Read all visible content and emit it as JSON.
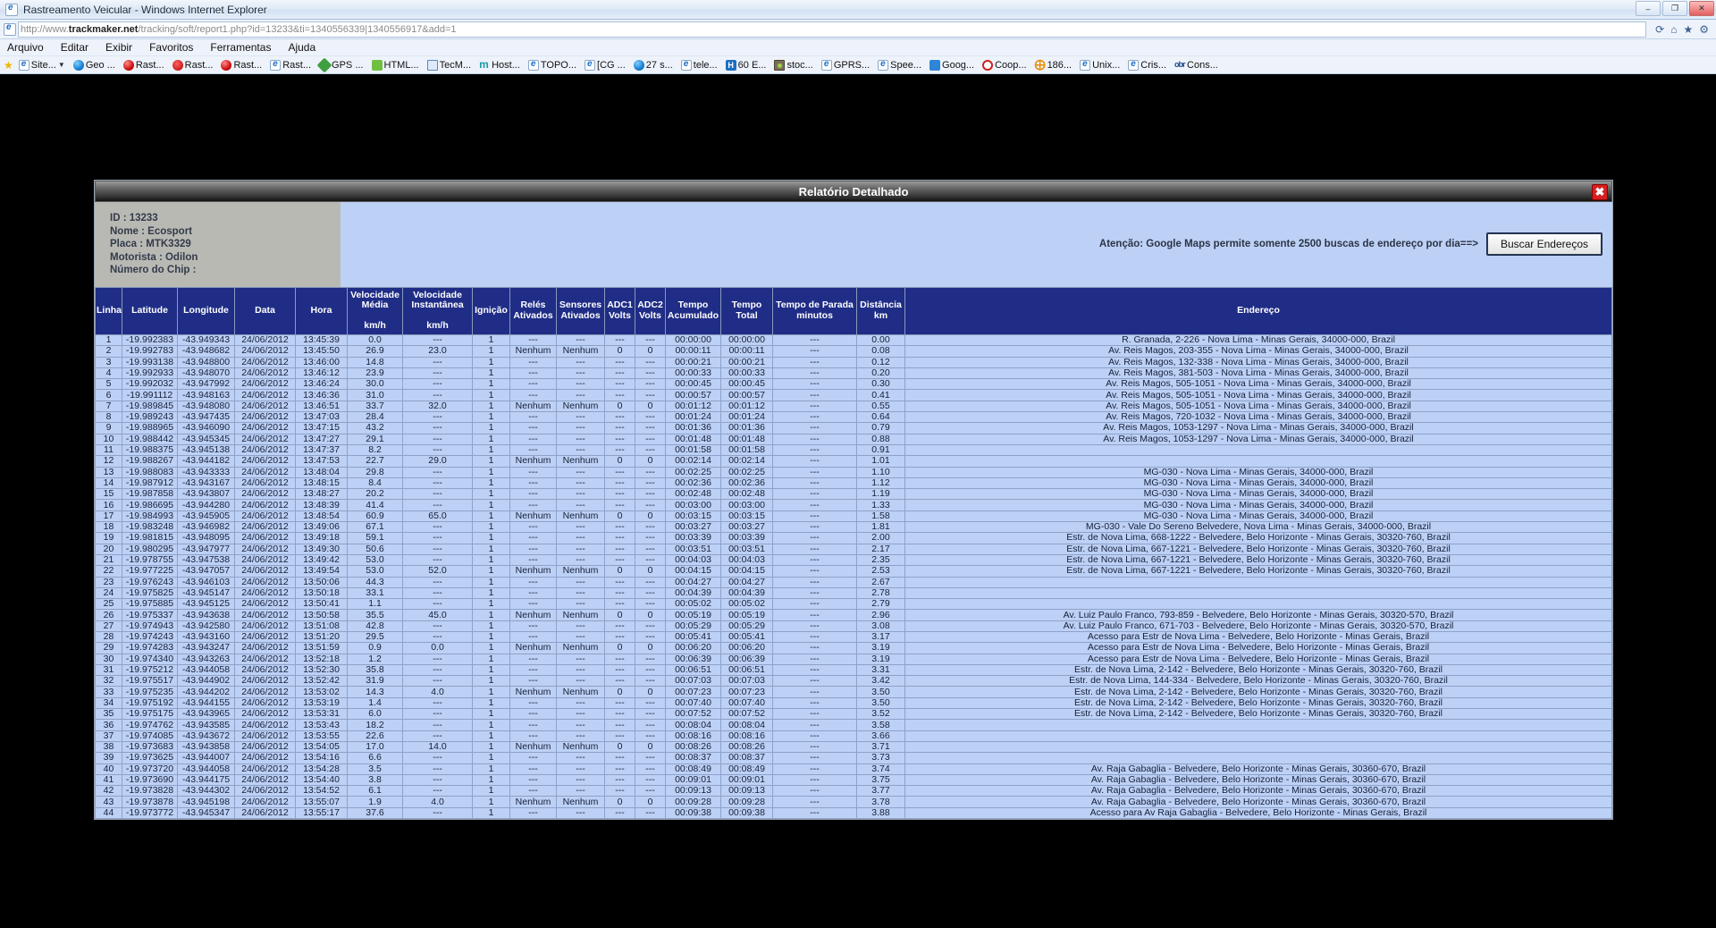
{
  "browser": {
    "window_title": "Rastreamento Veicular - Windows Internet Explorer",
    "url_prefix": "http://www.",
    "url_domain": "trackmaker.net",
    "url_path": "/tracking/soft/report1.php?id=13233&ti=1340556339|1340556917&add=1",
    "win_buttons": {
      "minimize": "–",
      "maximize": "❐",
      "close": "✕"
    },
    "addr_icons": {
      "refresh": "⟳",
      "home": "⌂",
      "star": "★",
      "gear": "⚙"
    },
    "menu": [
      "Arquivo",
      "Editar",
      "Exibir",
      "Favoritos",
      "Ferramentas",
      "Ajuda"
    ],
    "bookmarks": [
      {
        "label": "Site...",
        "icon": "ie-icon",
        "caret": true
      },
      {
        "label": "Geo ...",
        "icon": "globe-icon"
      },
      {
        "label": "Rast...",
        "icon": "red-globe-icon"
      },
      {
        "label": "Rast...",
        "icon": "red-swirl-icon"
      },
      {
        "label": "Rast...",
        "icon": "red-globe-icon"
      },
      {
        "label": "Rast...",
        "icon": "ie-icon"
      },
      {
        "label": "GPS ...",
        "icon": "green-diamond-icon"
      },
      {
        "label": "HTML...",
        "icon": "html-icon"
      },
      {
        "label": "TecM...",
        "icon": "blue-doc-icon"
      },
      {
        "label": "Host...",
        "icon": "teal-m-icon"
      },
      {
        "label": "TOPO...",
        "icon": "ie-icon"
      },
      {
        "label": "[CG ...",
        "icon": "ie-icon"
      },
      {
        "label": "27 s...",
        "icon": "globe-icon"
      },
      {
        "label": "tele...",
        "icon": "ie-icon"
      },
      {
        "label": "60 E...",
        "icon": "blue-h-icon"
      },
      {
        "label": "stoc...",
        "icon": "dark-box-icon"
      },
      {
        "label": "GPRS...",
        "icon": "ie-icon"
      },
      {
        "label": "Spee...",
        "icon": "ie-icon"
      },
      {
        "label": "Goog...",
        "icon": "google-icon"
      },
      {
        "label": "Coop...",
        "icon": "red-circle-icon"
      },
      {
        "label": "186...",
        "icon": "orange-icon"
      },
      {
        "label": "Unix...",
        "icon": "ie-icon"
      },
      {
        "label": "Cris...",
        "icon": "ie-icon"
      },
      {
        "label": "Cons...",
        "icon": "obr-icon"
      }
    ]
  },
  "report": {
    "title": "Relatório Detalhado",
    "close_label": "✖",
    "vehicle_info": [
      "ID : 13233",
      "Nome : Ecosport",
      "Placa : MTK3329",
      "Motorista : Odilon",
      "Número do Chip :"
    ],
    "warning": "Atenção: Google Maps permite somente 2500 buscas de endereço por dia==>",
    "search_button": "Buscar Endereços",
    "columns": [
      "Linha",
      "Latitude",
      "Longitude",
      "Data",
      "Hora",
      "Velocidade Média km/h",
      "Velocidade Instantânea km/h",
      "Ignição",
      "Relés Ativados",
      "Sensores Ativados",
      "ADC1 Volts",
      "ADC2 Volts",
      "Tempo Acumulado",
      "Tempo Total",
      "Tempo de Parada minutos",
      "Distância km",
      "Endereço"
    ],
    "rows": [
      [
        "1",
        "-19.992383",
        "-43.949343",
        "24/06/2012",
        "13:45:39",
        "0.0",
        "---",
        "1",
        "---",
        "---",
        "---",
        "---",
        "00:00:00",
        "00:00:00",
        "---",
        "0.00",
        "R. Granada, 2-226 - Nova Lima - Minas Gerais, 34000-000, Brazil"
      ],
      [
        "2",
        "-19.992783",
        "-43.948682",
        "24/06/2012",
        "13:45:50",
        "26.9",
        "23.0",
        "1",
        "Nenhum",
        "Nenhum",
        "0",
        "0",
        "00:00:11",
        "00:00:11",
        "---",
        "0.08",
        "Av. Reis Magos, 203-355 - Nova Lima - Minas Gerais, 34000-000, Brazil"
      ],
      [
        "3",
        "-19.993138",
        "-43.948800",
        "24/06/2012",
        "13:46:00",
        "14.8",
        "---",
        "1",
        "---",
        "---",
        "---",
        "---",
        "00:00:21",
        "00:00:21",
        "---",
        "0.12",
        "Av. Reis Magos, 132-338 - Nova Lima - Minas Gerais, 34000-000, Brazil"
      ],
      [
        "4",
        "-19.992933",
        "-43.948070",
        "24/06/2012",
        "13:46:12",
        "23.9",
        "---",
        "1",
        "---",
        "---",
        "---",
        "---",
        "00:00:33",
        "00:00:33",
        "---",
        "0.20",
        "Av. Reis Magos, 381-503 - Nova Lima - Minas Gerais, 34000-000, Brazil"
      ],
      [
        "5",
        "-19.992032",
        "-43.947992",
        "24/06/2012",
        "13:46:24",
        "30.0",
        "---",
        "1",
        "---",
        "---",
        "---",
        "---",
        "00:00:45",
        "00:00:45",
        "---",
        "0.30",
        "Av. Reis Magos, 505-1051 - Nova Lima - Minas Gerais, 34000-000, Brazil"
      ],
      [
        "6",
        "-19.991112",
        "-43.948163",
        "24/06/2012",
        "13:46:36",
        "31.0",
        "---",
        "1",
        "---",
        "---",
        "---",
        "---",
        "00:00:57",
        "00:00:57",
        "---",
        "0.41",
        "Av. Reis Magos, 505-1051 - Nova Lima - Minas Gerais, 34000-000, Brazil"
      ],
      [
        "7",
        "-19.989845",
        "-43.948080",
        "24/06/2012",
        "13:46:51",
        "33.7",
        "32.0",
        "1",
        "Nenhum",
        "Nenhum",
        "0",
        "0",
        "00:01:12",
        "00:01:12",
        "---",
        "0.55",
        "Av. Reis Magos, 505-1051 - Nova Lima - Minas Gerais, 34000-000, Brazil"
      ],
      [
        "8",
        "-19.989243",
        "-43.947435",
        "24/06/2012",
        "13:47:03",
        "28.4",
        "---",
        "1",
        "---",
        "---",
        "---",
        "---",
        "00:01:24",
        "00:01:24",
        "---",
        "0.64",
        "Av. Reis Magos, 720-1032 - Nova Lima - Minas Gerais, 34000-000, Brazil"
      ],
      [
        "9",
        "-19.988965",
        "-43.946090",
        "24/06/2012",
        "13:47:15",
        "43.2",
        "---",
        "1",
        "---",
        "---",
        "---",
        "---",
        "00:01:36",
        "00:01:36",
        "---",
        "0.79",
        "Av. Reis Magos, 1053-1297 - Nova Lima - Minas Gerais, 34000-000, Brazil"
      ],
      [
        "10",
        "-19.988442",
        "-43.945345",
        "24/06/2012",
        "13:47:27",
        "29.1",
        "---",
        "1",
        "---",
        "---",
        "---",
        "---",
        "00:01:48",
        "00:01:48",
        "---",
        "0.88",
        "Av. Reis Magos, 1053-1297 - Nova Lima - Minas Gerais, 34000-000, Brazil"
      ],
      [
        "11",
        "-19.988375",
        "-43.945138",
        "24/06/2012",
        "13:47:37",
        "8.2",
        "---",
        "1",
        "---",
        "---",
        "---",
        "---",
        "00:01:58",
        "00:01:58",
        "---",
        "0.91",
        ""
      ],
      [
        "12",
        "-19.988267",
        "-43.944182",
        "24/06/2012",
        "13:47:53",
        "22.7",
        "29.0",
        "1",
        "Nenhum",
        "Nenhum",
        "0",
        "0",
        "00:02:14",
        "00:02:14",
        "---",
        "1.01",
        ""
      ],
      [
        "13",
        "-19.988083",
        "-43.943333",
        "24/06/2012",
        "13:48:04",
        "29.8",
        "---",
        "1",
        "---",
        "---",
        "---",
        "---",
        "00:02:25",
        "00:02:25",
        "---",
        "1.10",
        "MG-030 - Nova Lima - Minas Gerais, 34000-000, Brazil"
      ],
      [
        "14",
        "-19.987912",
        "-43.943167",
        "24/06/2012",
        "13:48:15",
        "8.4",
        "---",
        "1",
        "---",
        "---",
        "---",
        "---",
        "00:02:36",
        "00:02:36",
        "---",
        "1.12",
        "MG-030 - Nova Lima - Minas Gerais, 34000-000, Brazil"
      ],
      [
        "15",
        "-19.987858",
        "-43.943807",
        "24/06/2012",
        "13:48:27",
        "20.2",
        "---",
        "1",
        "---",
        "---",
        "---",
        "---",
        "00:02:48",
        "00:02:48",
        "---",
        "1.19",
        "MG-030 - Nova Lima - Minas Gerais, 34000-000, Brazil"
      ],
      [
        "16",
        "-19.986695",
        "-43.944280",
        "24/06/2012",
        "13:48:39",
        "41.4",
        "---",
        "1",
        "---",
        "---",
        "---",
        "---",
        "00:03:00",
        "00:03:00",
        "---",
        "1.33",
        "MG-030 - Nova Lima - Minas Gerais, 34000-000, Brazil"
      ],
      [
        "17",
        "-19.984993",
        "-43.945905",
        "24/06/2012",
        "13:48:54",
        "60.9",
        "65.0",
        "1",
        "Nenhum",
        "Nenhum",
        "0",
        "0",
        "00:03:15",
        "00:03:15",
        "---",
        "1.58",
        "MG-030 - Nova Lima - Minas Gerais, 34000-000, Brazil"
      ],
      [
        "18",
        "-19.983248",
        "-43.946982",
        "24/06/2012",
        "13:49:06",
        "67.1",
        "---",
        "1",
        "---",
        "---",
        "---",
        "---",
        "00:03:27",
        "00:03:27",
        "---",
        "1.81",
        "MG-030 - Vale Do Sereno Belvedere, Nova Lima - Minas Gerais, 34000-000, Brazil"
      ],
      [
        "19",
        "-19.981815",
        "-43.948095",
        "24/06/2012",
        "13:49:18",
        "59.1",
        "---",
        "1",
        "---",
        "---",
        "---",
        "---",
        "00:03:39",
        "00:03:39",
        "---",
        "2.00",
        "Estr. de Nova Lima, 668-1222 - Belvedere, Belo Horizonte - Minas Gerais, 30320-760, Brazil"
      ],
      [
        "20",
        "-19.980295",
        "-43.947977",
        "24/06/2012",
        "13:49:30",
        "50.6",
        "---",
        "1",
        "---",
        "---",
        "---",
        "---",
        "00:03:51",
        "00:03:51",
        "---",
        "2.17",
        "Estr. de Nova Lima, 667-1221 - Belvedere, Belo Horizonte - Minas Gerais, 30320-760, Brazil"
      ],
      [
        "21",
        "-19.978755",
        "-43.947538",
        "24/06/2012",
        "13:49:42",
        "53.0",
        "---",
        "1",
        "---",
        "---",
        "---",
        "---",
        "00:04:03",
        "00:04:03",
        "---",
        "2.35",
        "Estr. de Nova Lima, 667-1221 - Belvedere, Belo Horizonte - Minas Gerais, 30320-760, Brazil"
      ],
      [
        "22",
        "-19.977225",
        "-43.947057",
        "24/06/2012",
        "13:49:54",
        "53.0",
        "52.0",
        "1",
        "Nenhum",
        "Nenhum",
        "0",
        "0",
        "00:04:15",
        "00:04:15",
        "---",
        "2.53",
        "Estr. de Nova Lima, 667-1221 - Belvedere, Belo Horizonte - Minas Gerais, 30320-760, Brazil"
      ],
      [
        "23",
        "-19.976243",
        "-43.946103",
        "24/06/2012",
        "13:50:06",
        "44.3",
        "---",
        "1",
        "---",
        "---",
        "---",
        "---",
        "00:04:27",
        "00:04:27",
        "---",
        "2.67",
        ""
      ],
      [
        "24",
        "-19.975825",
        "-43.945147",
        "24/06/2012",
        "13:50:18",
        "33.1",
        "---",
        "1",
        "---",
        "---",
        "---",
        "---",
        "00:04:39",
        "00:04:39",
        "---",
        "2.78",
        ""
      ],
      [
        "25",
        "-19.975885",
        "-43.945125",
        "24/06/2012",
        "13:50:41",
        "1.1",
        "---",
        "1",
        "---",
        "---",
        "---",
        "---",
        "00:05:02",
        "00:05:02",
        "---",
        "2.79",
        ""
      ],
      [
        "26",
        "-19.975337",
        "-43.943638",
        "24/06/2012",
        "13:50:58",
        "35.5",
        "45.0",
        "1",
        "Nenhum",
        "Nenhum",
        "0",
        "0",
        "00:05:19",
        "00:05:19",
        "---",
        "2.96",
        "Av. Luiz Paulo Franco, 793-859 - Belvedere, Belo Horizonte - Minas Gerais, 30320-570, Brazil"
      ],
      [
        "27",
        "-19.974943",
        "-43.942580",
        "24/06/2012",
        "13:51:08",
        "42.8",
        "---",
        "1",
        "---",
        "---",
        "---",
        "---",
        "00:05:29",
        "00:05:29",
        "---",
        "3.08",
        "Av. Luiz Paulo Franco, 671-703 - Belvedere, Belo Horizonte - Minas Gerais, 30320-570, Brazil"
      ],
      [
        "28",
        "-19.974243",
        "-43.943160",
        "24/06/2012",
        "13:51:20",
        "29.5",
        "---",
        "1",
        "---",
        "---",
        "---",
        "---",
        "00:05:41",
        "00:05:41",
        "---",
        "3.17",
        "Acesso para Estr de Nova Lima - Belvedere, Belo Horizonte - Minas Gerais, Brazil"
      ],
      [
        "29",
        "-19.974283",
        "-43.943247",
        "24/06/2012",
        "13:51:59",
        "0.9",
        "0.0",
        "1",
        "Nenhum",
        "Nenhum",
        "0",
        "0",
        "00:06:20",
        "00:06:20",
        "---",
        "3.19",
        "Acesso para Estr de Nova Lima - Belvedere, Belo Horizonte - Minas Gerais, Brazil"
      ],
      [
        "30",
        "-19.974340",
        "-43.943263",
        "24/06/2012",
        "13:52:18",
        "1.2",
        "---",
        "1",
        "---",
        "---",
        "---",
        "---",
        "00:06:39",
        "00:06:39",
        "---",
        "3.19",
        "Acesso para Estr de Nova Lima - Belvedere, Belo Horizonte - Minas Gerais, Brazil"
      ],
      [
        "31",
        "-19.975212",
        "-43.944058",
        "24/06/2012",
        "13:52:30",
        "35.8",
        "---",
        "1",
        "---",
        "---",
        "---",
        "---",
        "00:06:51",
        "00:06:51",
        "---",
        "3.31",
        "Estr. de Nova Lima, 2-142 - Belvedere, Belo Horizonte - Minas Gerais, 30320-760, Brazil"
      ],
      [
        "32",
        "-19.975517",
        "-43.944902",
        "24/06/2012",
        "13:52:42",
        "31.9",
        "---",
        "1",
        "---",
        "---",
        "---",
        "---",
        "00:07:03",
        "00:07:03",
        "---",
        "3.42",
        "Estr. de Nova Lima, 144-334 - Belvedere, Belo Horizonte - Minas Gerais, 30320-760, Brazil"
      ],
      [
        "33",
        "-19.975235",
        "-43.944202",
        "24/06/2012",
        "13:53:02",
        "14.3",
        "4.0",
        "1",
        "Nenhum",
        "Nenhum",
        "0",
        "0",
        "00:07:23",
        "00:07:23",
        "---",
        "3.50",
        "Estr. de Nova Lima, 2-142 - Belvedere, Belo Horizonte - Minas Gerais, 30320-760, Brazil"
      ],
      [
        "34",
        "-19.975192",
        "-43.944155",
        "24/06/2012",
        "13:53:19",
        "1.4",
        "---",
        "1",
        "---",
        "---",
        "---",
        "---",
        "00:07:40",
        "00:07:40",
        "---",
        "3.50",
        "Estr. de Nova Lima, 2-142 - Belvedere, Belo Horizonte - Minas Gerais, 30320-760, Brazil"
      ],
      [
        "35",
        "-19.975175",
        "-43.943965",
        "24/06/2012",
        "13:53:31",
        "6.0",
        "---",
        "1",
        "---",
        "---",
        "---",
        "---",
        "00:07:52",
        "00:07:52",
        "---",
        "3.52",
        "Estr. de Nova Lima, 2-142 - Belvedere, Belo Horizonte - Minas Gerais, 30320-760, Brazil"
      ],
      [
        "36",
        "-19.974762",
        "-43.943585",
        "24/06/2012",
        "13:53:43",
        "18.2",
        "---",
        "1",
        "---",
        "---",
        "---",
        "---",
        "00:08:04",
        "00:08:04",
        "---",
        "3.58",
        ""
      ],
      [
        "37",
        "-19.974085",
        "-43.943672",
        "24/06/2012",
        "13:53:55",
        "22.6",
        "---",
        "1",
        "---",
        "---",
        "---",
        "---",
        "00:08:16",
        "00:08:16",
        "---",
        "3.66",
        ""
      ],
      [
        "38",
        "-19.973683",
        "-43.943858",
        "24/06/2012",
        "13:54:05",
        "17.0",
        "14.0",
        "1",
        "Nenhum",
        "Nenhum",
        "0",
        "0",
        "00:08:26",
        "00:08:26",
        "---",
        "3.71",
        ""
      ],
      [
        "39",
        "-19.973625",
        "-43.944007",
        "24/06/2012",
        "13:54:16",
        "6.6",
        "---",
        "1",
        "---",
        "---",
        "---",
        "---",
        "00:08:37",
        "00:08:37",
        "---",
        "3.73",
        ""
      ],
      [
        "40",
        "-19.973720",
        "-43.944058",
        "24/06/2012",
        "13:54:28",
        "3.5",
        "---",
        "1",
        "---",
        "---",
        "---",
        "---",
        "00:08:49",
        "00:08:49",
        "---",
        "3.74",
        "Av. Raja Gabaglia - Belvedere, Belo Horizonte - Minas Gerais, 30360-670, Brazil"
      ],
      [
        "41",
        "-19.973690",
        "-43.944175",
        "24/06/2012",
        "13:54:40",
        "3.8",
        "---",
        "1",
        "---",
        "---",
        "---",
        "---",
        "00:09:01",
        "00:09:01",
        "---",
        "3.75",
        "Av. Raja Gabaglia - Belvedere, Belo Horizonte - Minas Gerais, 30360-670, Brazil"
      ],
      [
        "42",
        "-19.973828",
        "-43.944302",
        "24/06/2012",
        "13:54:52",
        "6.1",
        "---",
        "1",
        "---",
        "---",
        "---",
        "---",
        "00:09:13",
        "00:09:13",
        "---",
        "3.77",
        "Av. Raja Gabaglia - Belvedere, Belo Horizonte - Minas Gerais, 30360-670, Brazil"
      ],
      [
        "43",
        "-19.973878",
        "-43.945198",
        "24/06/2012",
        "13:55:07",
        "1.9",
        "4.0",
        "1",
        "Nenhum",
        "Nenhum",
        "0",
        "0",
        "00:09:28",
        "00:09:28",
        "---",
        "3.78",
        "Av. Raja Gabaglia - Belvedere, Belo Horizonte - Minas Gerais, 30360-670, Brazil"
      ],
      [
        "44",
        "-19.973772",
        "-43.945347",
        "24/06/2012",
        "13:55:17",
        "37.6",
        "---",
        "1",
        "---",
        "---",
        "---",
        "---",
        "00:09:38",
        "00:09:38",
        "---",
        "3.88",
        "Acesso para Av Raja Gabaglia - Belvedere, Belo Horizonte - Minas Gerais, Brazil"
      ]
    ]
  }
}
